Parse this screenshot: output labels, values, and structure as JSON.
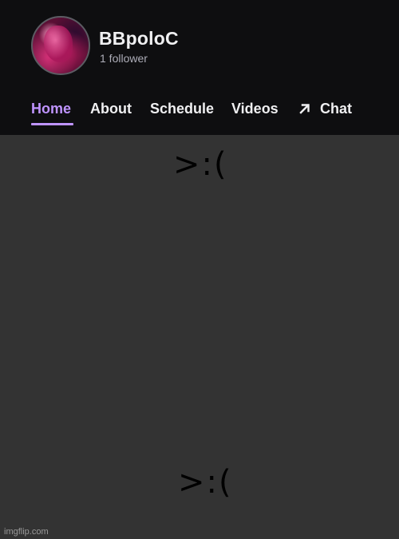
{
  "channel": {
    "name": "BBpoloC",
    "followers": "1 follower"
  },
  "nav": {
    "tabs": [
      {
        "label": "Home",
        "active": true
      },
      {
        "label": "About",
        "active": false
      },
      {
        "label": "Schedule",
        "active": false
      },
      {
        "label": "Videos",
        "active": false
      },
      {
        "label": "Chat",
        "active": false,
        "icon": "external-arrow-icon"
      }
    ],
    "active_color": "#bf94ff"
  },
  "content": {
    "caption_top": ">:(",
    "caption_bottom": ">:("
  },
  "watermark": "imgflip.com",
  "colors": {
    "header_bg": "#0e0e10",
    "body_bg": "#333333"
  }
}
